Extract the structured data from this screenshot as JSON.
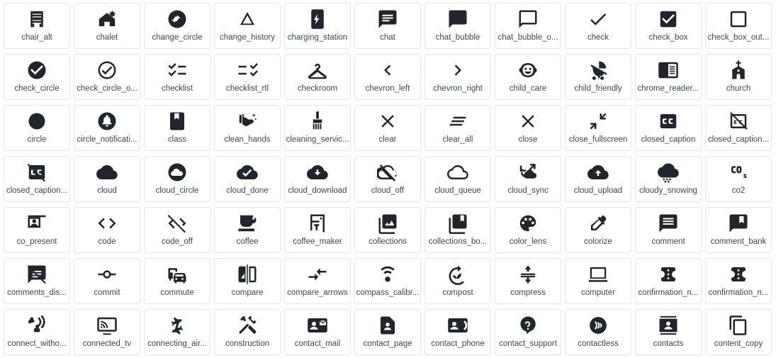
{
  "gallery": {
    "columns": 11,
    "rows": 7,
    "accent_text_color": "#3d4a57",
    "icon_color": "#21262c",
    "card_border_color": "#e3e6ea",
    "background_color": "#ffffff",
    "icons": [
      {
        "label": "chair_alt",
        "icon": "chair-alt-icon"
      },
      {
        "label": "chalet",
        "icon": "chalet-icon"
      },
      {
        "label": "change_circle",
        "icon": "change-circle-icon"
      },
      {
        "label": "change_history",
        "icon": "change-history-icon"
      },
      {
        "label": "charging_station",
        "icon": "charging-station-icon"
      },
      {
        "label": "chat",
        "icon": "chat-icon"
      },
      {
        "label": "chat_bubble",
        "icon": "chat-bubble-icon"
      },
      {
        "label": "chat_bubble_o...",
        "icon": "chat-bubble-outline-icon"
      },
      {
        "label": "check",
        "icon": "check-icon"
      },
      {
        "label": "check_box",
        "icon": "check-box-icon"
      },
      {
        "label": "check_box_out...",
        "icon": "check-box-outline-blank-icon"
      },
      {
        "label": "check_circle",
        "icon": "check-circle-icon"
      },
      {
        "label": "check_circle_o...",
        "icon": "check-circle-outline-icon"
      },
      {
        "label": "checklist",
        "icon": "checklist-icon"
      },
      {
        "label": "checklist_rtl",
        "icon": "checklist-rtl-icon"
      },
      {
        "label": "checkroom",
        "icon": "checkroom-icon"
      },
      {
        "label": "chevron_left",
        "icon": "chevron-left-icon"
      },
      {
        "label": "chevron_right",
        "icon": "chevron-right-icon"
      },
      {
        "label": "child_care",
        "icon": "child-care-icon"
      },
      {
        "label": "child_friendly",
        "icon": "child-friendly-icon"
      },
      {
        "label": "chrome_reader...",
        "icon": "chrome-reader-mode-icon"
      },
      {
        "label": "church",
        "icon": "church-icon"
      },
      {
        "label": "circle",
        "icon": "circle-icon"
      },
      {
        "label": "circle_notificati...",
        "icon": "circle-notifications-icon"
      },
      {
        "label": "class",
        "icon": "class-icon"
      },
      {
        "label": "clean_hands",
        "icon": "clean-hands-icon"
      },
      {
        "label": "cleaning_servic...",
        "icon": "cleaning-services-icon"
      },
      {
        "label": "clear",
        "icon": "clear-icon"
      },
      {
        "label": "clear_all",
        "icon": "clear-all-icon"
      },
      {
        "label": "close",
        "icon": "close-icon"
      },
      {
        "label": "close_fullscreen",
        "icon": "close-fullscreen-icon"
      },
      {
        "label": "closed_caption",
        "icon": "closed-caption-icon"
      },
      {
        "label": "closed_caption...",
        "icon": "closed-caption-off-icon"
      },
      {
        "label": "closed_caption...",
        "icon": "closed-caption-disabled-icon"
      },
      {
        "label": "cloud",
        "icon": "cloud-icon"
      },
      {
        "label": "cloud_circle",
        "icon": "cloud-circle-icon"
      },
      {
        "label": "cloud_done",
        "icon": "cloud-done-icon"
      },
      {
        "label": "cloud_download",
        "icon": "cloud-download-icon"
      },
      {
        "label": "cloud_off",
        "icon": "cloud-off-icon"
      },
      {
        "label": "cloud_queue",
        "icon": "cloud-queue-icon"
      },
      {
        "label": "cloud_sync",
        "icon": "cloud-sync-icon"
      },
      {
        "label": "cloud_upload",
        "icon": "cloud-upload-icon"
      },
      {
        "label": "cloudy_snowing",
        "icon": "cloudy-snowing-icon"
      },
      {
        "label": "co2",
        "icon": "co2-icon"
      },
      {
        "label": "co_present",
        "icon": "co-present-icon"
      },
      {
        "label": "code",
        "icon": "code-icon"
      },
      {
        "label": "code_off",
        "icon": "code-off-icon"
      },
      {
        "label": "coffee",
        "icon": "coffee-icon"
      },
      {
        "label": "coffee_maker",
        "icon": "coffee-maker-icon"
      },
      {
        "label": "collections",
        "icon": "collections-icon"
      },
      {
        "label": "collections_bo...",
        "icon": "collections-bookmark-icon"
      },
      {
        "label": "color_lens",
        "icon": "color-lens-icon"
      },
      {
        "label": "colorize",
        "icon": "colorize-icon"
      },
      {
        "label": "comment",
        "icon": "comment-icon"
      },
      {
        "label": "comment_bank",
        "icon": "comment-bank-icon"
      },
      {
        "label": "comments_dis...",
        "icon": "comments-disabled-icon"
      },
      {
        "label": "commit",
        "icon": "commit-icon"
      },
      {
        "label": "commute",
        "icon": "commute-icon"
      },
      {
        "label": "compare",
        "icon": "compare-icon"
      },
      {
        "label": "compare_arrows",
        "icon": "compare-arrows-icon"
      },
      {
        "label": "compass_calibr...",
        "icon": "compass-calibration-icon"
      },
      {
        "label": "compost",
        "icon": "compost-icon"
      },
      {
        "label": "compress",
        "icon": "compress-icon"
      },
      {
        "label": "computer",
        "icon": "computer-icon"
      },
      {
        "label": "confirmation_n...",
        "icon": "confirmation-number-icon"
      },
      {
        "label": "confirmation_n...",
        "icon": "confirmation-number-alt-icon"
      },
      {
        "label": "connect_witho...",
        "icon": "connect-without-contact-icon"
      },
      {
        "label": "connected_tv",
        "icon": "connected-tv-icon"
      },
      {
        "label": "connecting_air...",
        "icon": "connecting-airports-icon"
      },
      {
        "label": "construction",
        "icon": "construction-icon"
      },
      {
        "label": "contact_mail",
        "icon": "contact-mail-icon"
      },
      {
        "label": "contact_page",
        "icon": "contact-page-icon"
      },
      {
        "label": "contact_phone",
        "icon": "contact-phone-icon"
      },
      {
        "label": "contact_support",
        "icon": "contact-support-icon"
      },
      {
        "label": "contactless",
        "icon": "contactless-icon"
      },
      {
        "label": "contacts",
        "icon": "contacts-icon"
      },
      {
        "label": "content_copy",
        "icon": "content-copy-icon"
      }
    ]
  }
}
